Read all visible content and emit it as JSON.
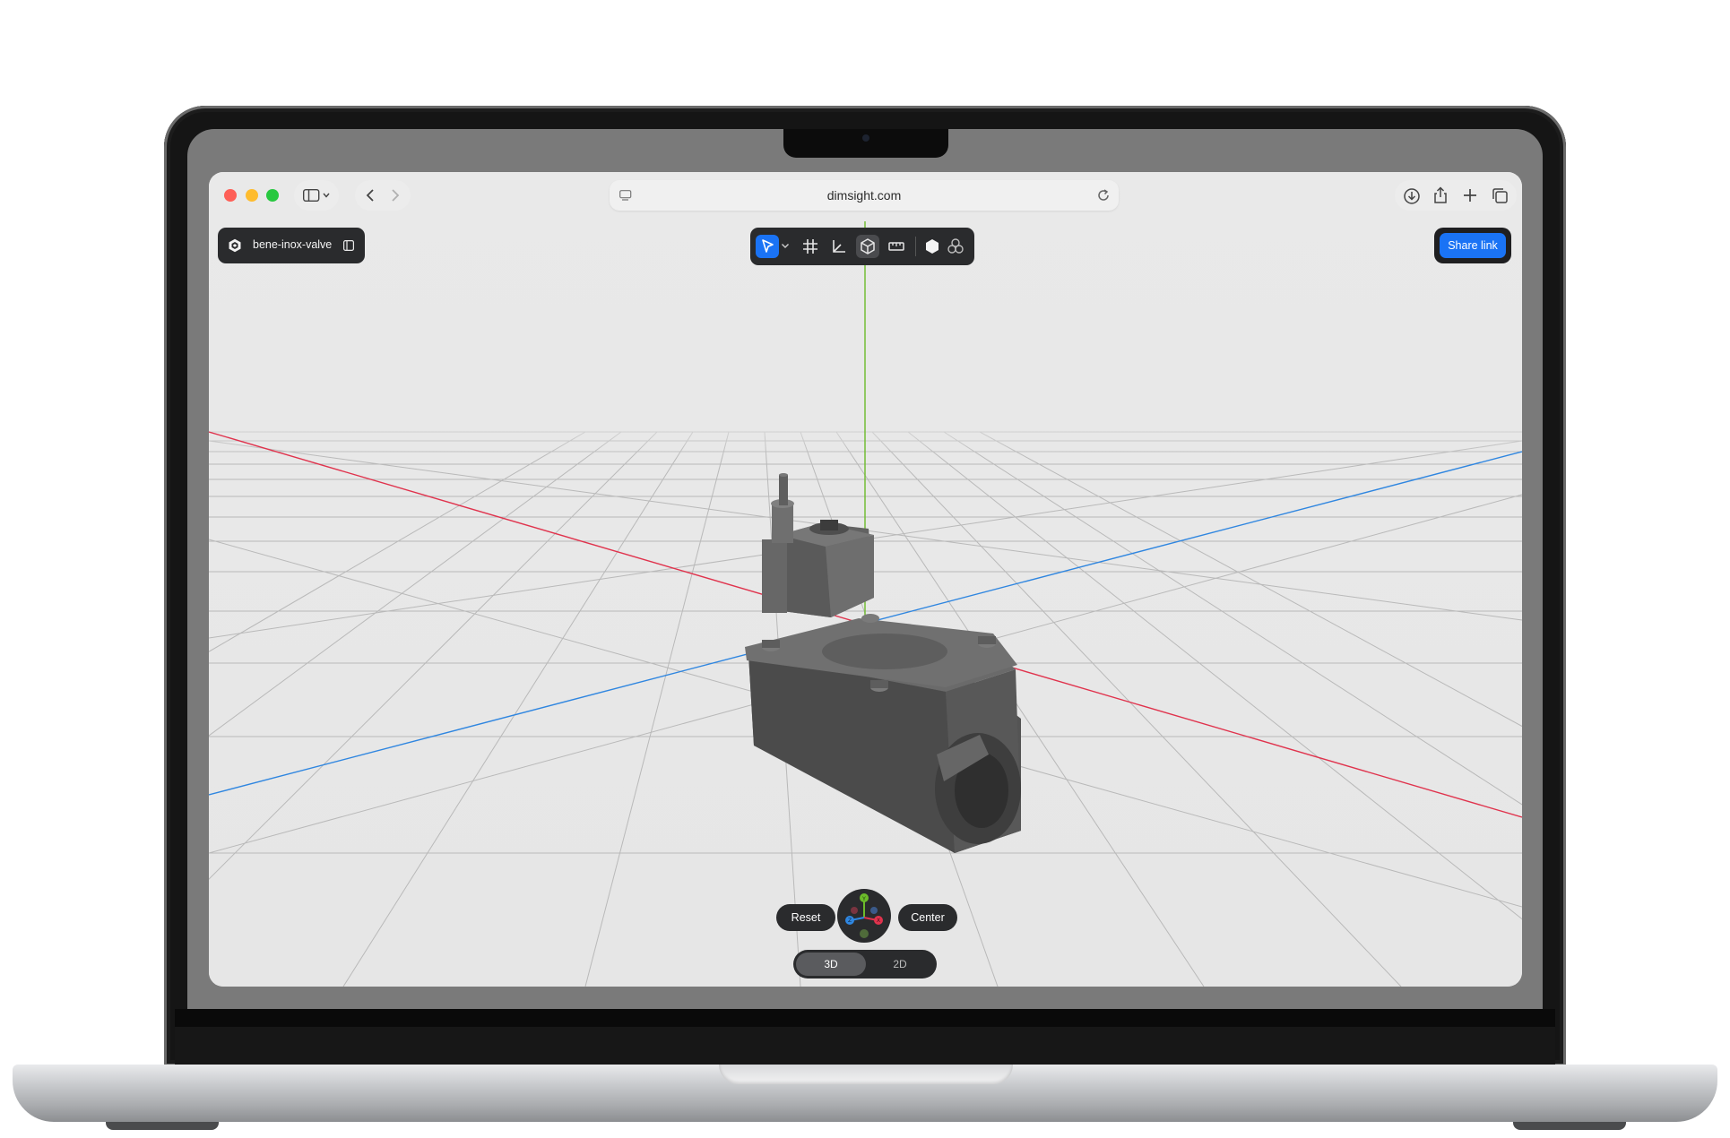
{
  "browser": {
    "url": "dimsight.com"
  },
  "project": {
    "name": "bene-inox-valve"
  },
  "toolbar": {
    "tools": [
      "select-tool",
      "select-dropdown",
      "grid-tool",
      "axes-tool",
      "box-view-tool",
      "measure-tool",
      "solid-mode",
      "components-mode"
    ],
    "active_tool": "select-tool"
  },
  "actions": {
    "share_label": "Share link",
    "reset_label": "Reset",
    "center_label": "Center"
  },
  "view_mode": {
    "options": [
      "3D",
      "2D"
    ],
    "selected": "3D"
  },
  "gizmo": {
    "axes": [
      "Y",
      "X",
      "Z"
    ]
  },
  "colors": {
    "accent": "#1a73f5",
    "x_axis": "#e0334d",
    "y_axis": "#6cbb2a",
    "z_axis": "#2f86e0"
  }
}
